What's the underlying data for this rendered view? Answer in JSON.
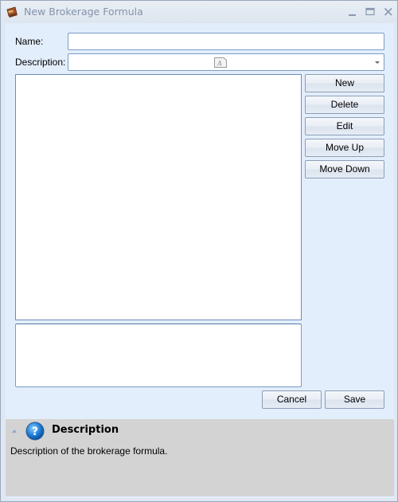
{
  "window": {
    "title": "New Brokerage Formula",
    "icons": {
      "app": "briefcase-icon",
      "minimize": "minimize-icon",
      "maximize": "maximize-icon",
      "close": "close-icon"
    }
  },
  "form": {
    "name_label": "Name:",
    "name_value": "",
    "description_label": "Description:",
    "description_value": ""
  },
  "side_buttons": {
    "new": "New",
    "delete": "Delete",
    "edit": "Edit",
    "move_up": "Move Up",
    "move_down": "Move Down"
  },
  "formula_list": {
    "items": []
  },
  "footer": {
    "cancel": "Cancel",
    "save": "Save"
  },
  "help": {
    "title": "Description",
    "text": "Description of the brokerage formula."
  }
}
